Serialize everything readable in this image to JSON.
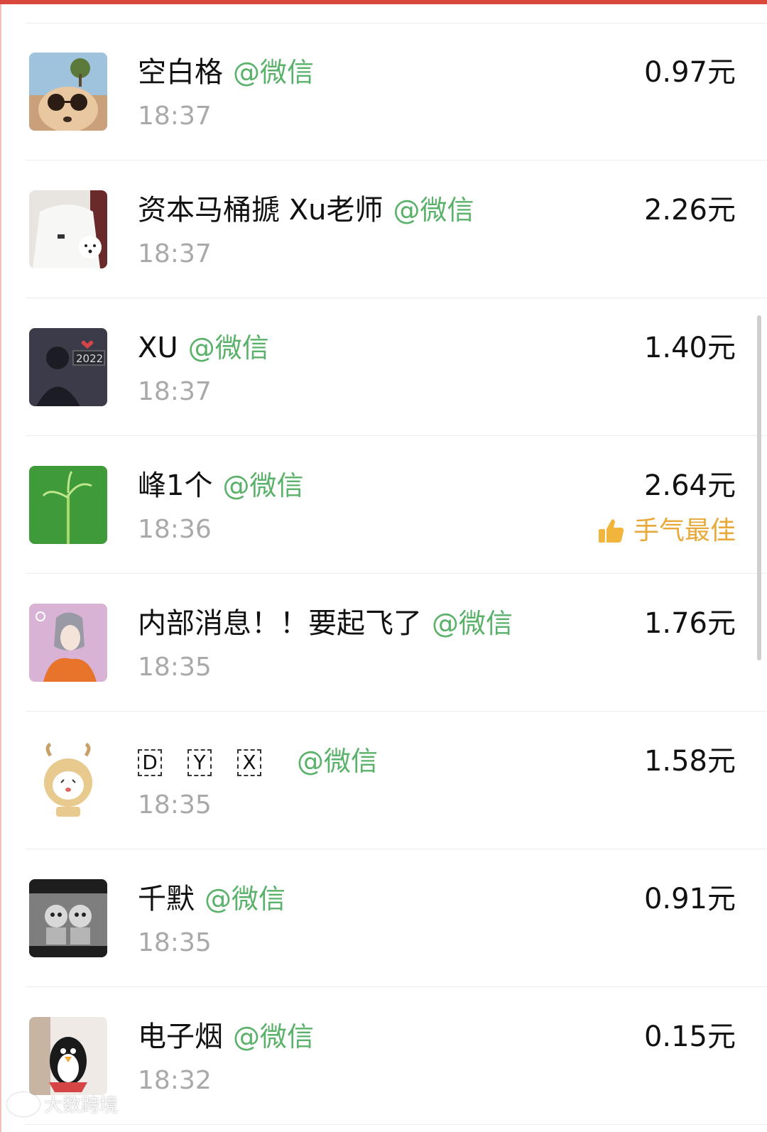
{
  "wechat_tag": "@微信",
  "currency_suffix": "元",
  "best_luck_label": "手气最佳",
  "watermark": "大数跨境",
  "rows": [
    {
      "name": "空白格",
      "time": "18:37",
      "amount": "0.97元",
      "avatar": "sunglasses-dog-avatar"
    },
    {
      "name": "资本马桶搋 Xu老师",
      "time": "18:37",
      "amount": "2.26元",
      "avatar": "person-with-dog-avatar"
    },
    {
      "name": "XU",
      "time": "18:37",
      "amount": "1.40元",
      "avatar": "silhouette-2022-avatar"
    },
    {
      "name": "峰1个",
      "time": "18:36",
      "amount": "2.64元",
      "avatar": "green-plant-avatar",
      "best": true
    },
    {
      "name": "内部消息！！要起飞了",
      "time": "18:35",
      "amount": "1.76元",
      "avatar": "anime-boy-avatar"
    },
    {
      "name": "DYX",
      "chars": [
        "D",
        "Y",
        "X"
      ],
      "time": "18:35",
      "amount": "1.58元",
      "avatar": "cartoon-ox-avatar"
    },
    {
      "name": "千默",
      "time": "18:35",
      "amount": "0.91元",
      "avatar": "cartoon-couple-avatar"
    },
    {
      "name": "电子烟",
      "time": "18:32",
      "amount": "0.15元",
      "avatar": "penguin-toy-avatar"
    }
  ]
}
